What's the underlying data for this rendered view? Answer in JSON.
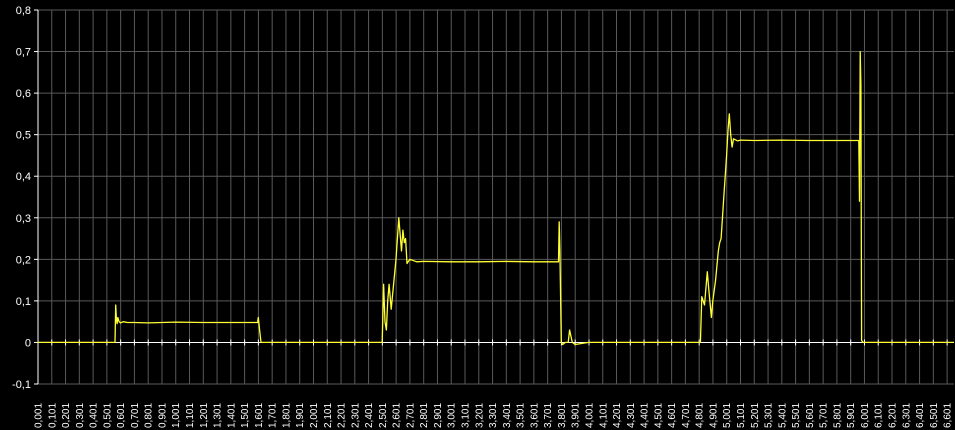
{
  "chart_data": {
    "type": "line",
    "title": "",
    "xlabel": "",
    "ylabel": "",
    "xlim": [
      0.001,
      6.651
    ],
    "ylim": [
      -0.1,
      0.8
    ],
    "y_ticks": [
      "-0,1",
      "0",
      "0,1",
      "0,2",
      "0,3",
      "0,4",
      "0,5",
      "0,6",
      "0,7",
      "0,8"
    ],
    "y_tick_values": [
      -0.1,
      0,
      0.1,
      0.2,
      0.3,
      0.4,
      0.5,
      0.6,
      0.7,
      0.8
    ],
    "x_tick_start": 0.001,
    "x_tick_step": 0.1,
    "x_tick_count": 67,
    "grid": true,
    "legend": "none",
    "colors": {
      "background": "#000000",
      "grid": "#5a5a5a",
      "axis": "#ffffff",
      "series": "#ffff33"
    },
    "series": [
      {
        "name": "",
        "x": [
          0.001,
          0.55,
          0.56,
          0.565,
          0.57,
          0.575,
          0.58,
          0.59,
          0.6,
          0.62,
          0.65,
          0.7,
          0.8,
          1.0,
          1.2,
          1.4,
          1.55,
          1.595,
          1.6,
          1.61,
          1.62,
          1.7,
          2.0,
          2.3,
          2.45,
          2.5,
          2.51,
          2.52,
          2.53,
          2.54,
          2.55,
          2.56,
          2.565,
          2.58,
          2.6,
          2.62,
          2.64,
          2.65,
          2.66,
          2.67,
          2.68,
          2.7,
          2.75,
          2.8,
          3.0,
          3.2,
          3.4,
          3.6,
          3.77,
          3.78,
          3.785,
          3.79,
          3.8,
          3.81,
          3.83,
          3.85,
          3.86,
          3.88,
          3.9,
          4.0,
          4.2,
          4.4,
          4.6,
          4.81,
          4.82,
          4.84,
          4.86,
          4.87,
          4.89,
          4.9,
          4.92,
          4.94,
          4.95,
          4.96,
          4.98,
          5.0,
          5.01,
          5.02,
          5.03,
          5.04,
          5.05,
          5.08,
          5.1,
          5.2,
          5.4,
          5.6,
          5.8,
          5.95,
          5.96,
          5.965,
          5.97,
          5.975,
          5.98,
          5.99,
          6.0,
          6.3,
          6.651
        ],
        "y": [
          0,
          0,
          0,
          0.09,
          0.055,
          0.045,
          0.06,
          0.05,
          0.047,
          0.05,
          0.048,
          0.048,
          0.047,
          0.049,
          0.048,
          0.048,
          0.048,
          0.048,
          0.06,
          0.03,
          0,
          0,
          0,
          0,
          0,
          0,
          0.14,
          0.05,
          0.03,
          0.1,
          0.14,
          0.1,
          0.08,
          0.13,
          0.2,
          0.3,
          0.22,
          0.27,
          0.24,
          0.25,
          0.19,
          0.2,
          0.194,
          0.195,
          0.194,
          0.194,
          0.195,
          0.194,
          0.194,
          0.194,
          0.29,
          0.22,
          0,
          -0.005,
          0,
          0,
          0.03,
          0.0,
          -0.005,
          0,
          0,
          0,
          0,
          0,
          0.11,
          0.09,
          0.17,
          0.13,
          0.06,
          0.1,
          0.15,
          0.22,
          0.24,
          0.25,
          0.35,
          0.45,
          0.51,
          0.55,
          0.5,
          0.47,
          0.49,
          0.485,
          0.487,
          0.486,
          0.487,
          0.486,
          0.486,
          0.486,
          0.486,
          0.34,
          0.7,
          0.62,
          0.005,
          0,
          0,
          0,
          0
        ]
      }
    ]
  }
}
